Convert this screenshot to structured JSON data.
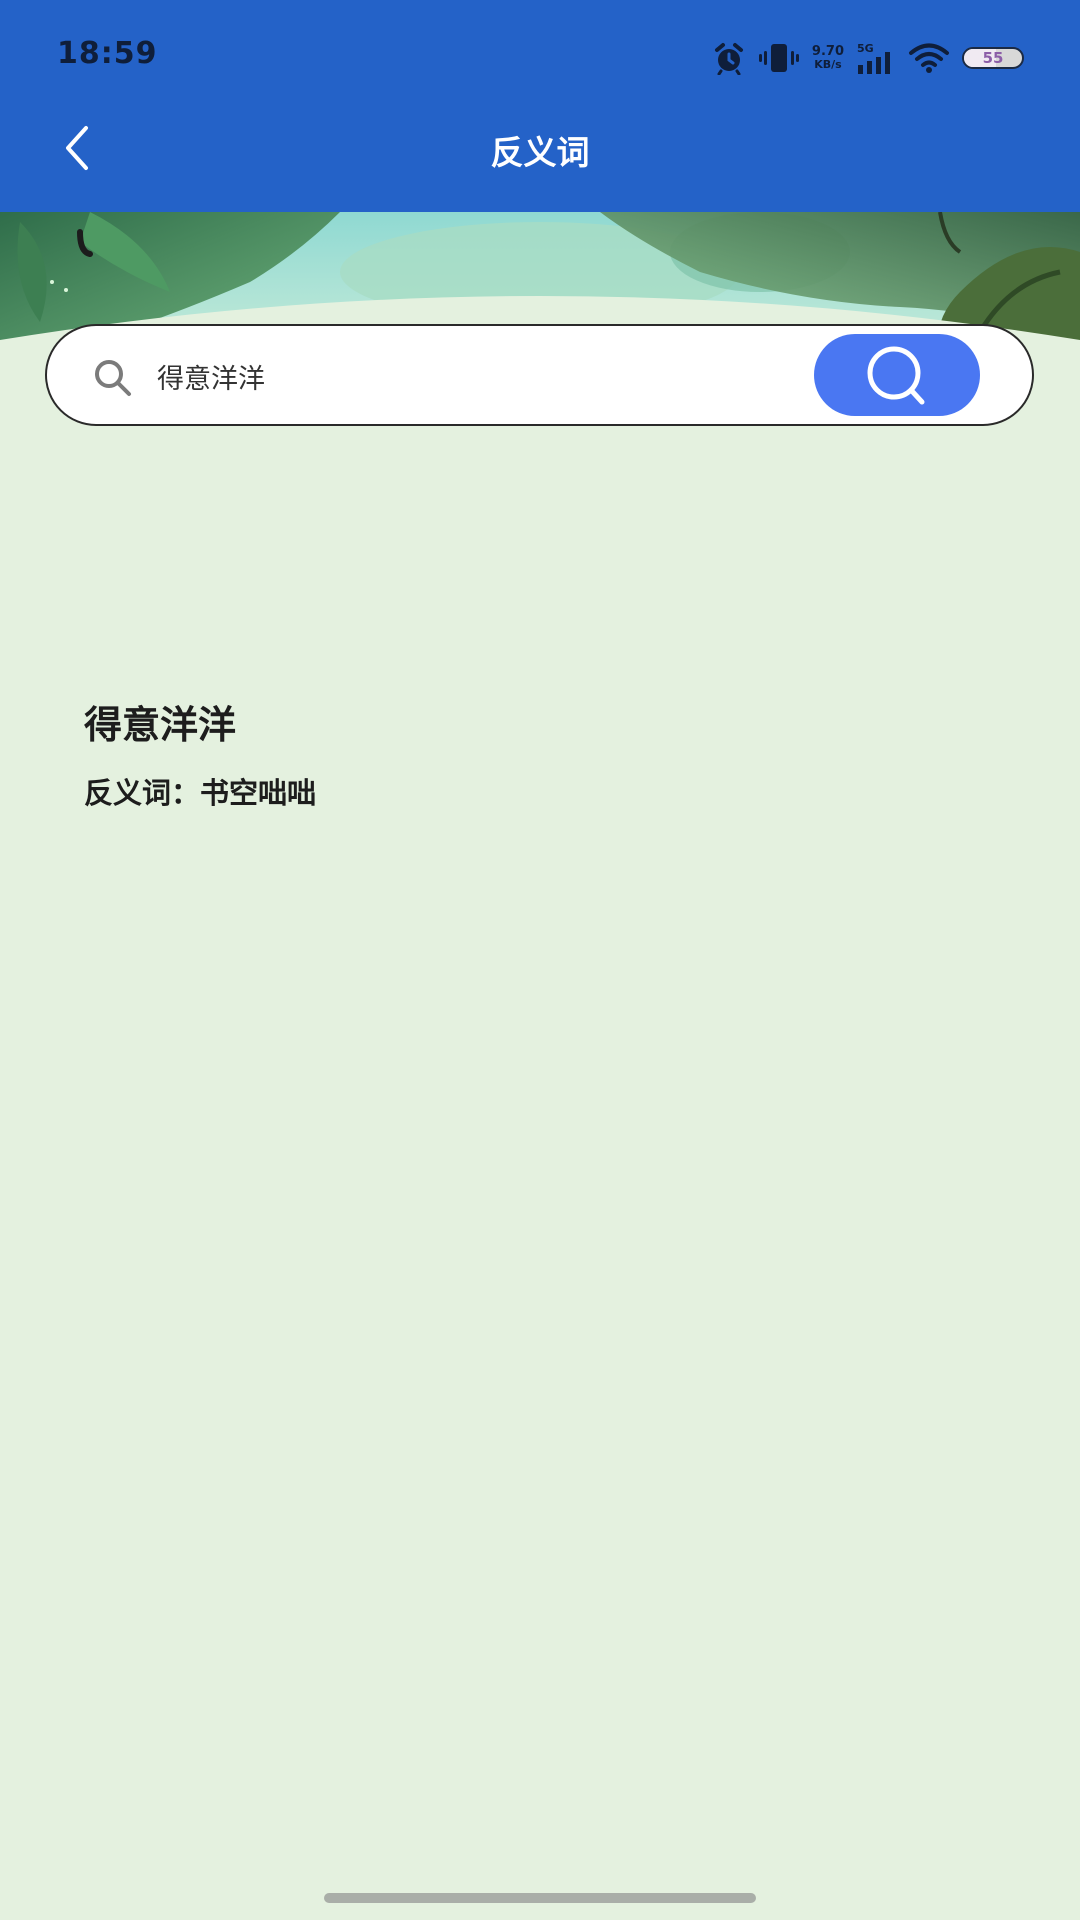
{
  "status_bar": {
    "time": "18:59",
    "net_speed_value": "9.70",
    "net_speed_unit": "KB/s",
    "network_type": "5G",
    "battery_level": "55",
    "battery_fraction": 0.55
  },
  "header": {
    "title": "反义词",
    "back_icon": "chevron-left-icon"
  },
  "search": {
    "value": "得意洋洋",
    "icon": "search-icon",
    "button_icon": "search-icon"
  },
  "result": {
    "word": "得意洋洋",
    "antonym_line": "反义词：书空咄咄"
  },
  "colors": {
    "header_bg": "#2462c8",
    "page_bg": "#e4f1df",
    "search_button": "#4a77f2"
  }
}
